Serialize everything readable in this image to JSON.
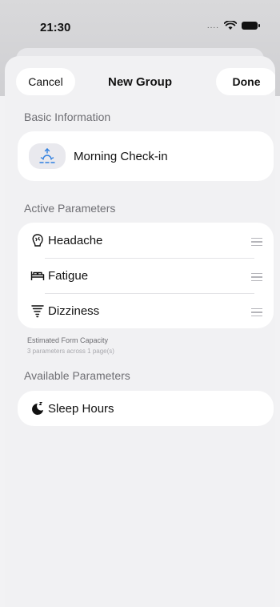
{
  "status_bar": {
    "time": "21:30",
    "signal": "....",
    "wifi_icon": "wifi-icon",
    "battery_icon": "battery-icon"
  },
  "nav": {
    "cancel_label": "Cancel",
    "title": "New Group",
    "done_label": "Done"
  },
  "basic_info": {
    "header": "Basic Information",
    "icon": "sunrise-icon",
    "name": "Morning Check-in"
  },
  "active_parameters": {
    "header": "Active Parameters",
    "items": [
      {
        "label": "Headache",
        "icon": "head-icon"
      },
      {
        "label": "Fatigue",
        "icon": "bed-icon"
      },
      {
        "label": "Dizziness",
        "icon": "tornado-icon"
      }
    ]
  },
  "capacity": {
    "title": "Estimated Form Capacity",
    "subtitle": "3 parameters across 1 page(s)"
  },
  "available_parameters": {
    "header": "Available Parameters",
    "items": [
      {
        "label": "Sleep Hours",
        "icon": "moon-zzz-icon"
      }
    ]
  },
  "colors": {
    "accent": "#2f7fe0",
    "background": "#f1f1f3",
    "card": "#ffffff",
    "secondary_text": "#6e6e73"
  }
}
